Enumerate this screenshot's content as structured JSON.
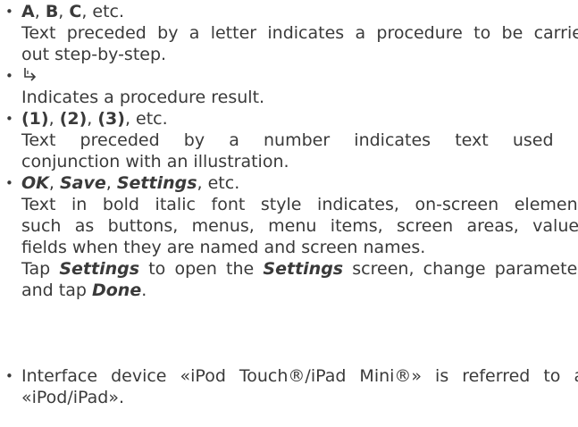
{
  "items": [
    {
      "lead": [
        {
          "text": "A",
          "style": "b"
        },
        {
          "text": ", ",
          "style": ""
        },
        {
          "text": "B",
          "style": "b"
        },
        {
          "text": ", ",
          "style": ""
        },
        {
          "text": "C",
          "style": "b"
        },
        {
          "text": ", etc.",
          "style": ""
        }
      ],
      "lines": [
        "Text preceded by a letter indicates a procedure to be carried",
        "out step-by-step."
      ]
    },
    {
      "symbol": "↳",
      "lines": [
        "Indicates a procedure result."
      ]
    },
    {
      "lead": [
        {
          "text": "(1)",
          "style": "b"
        },
        {
          "text": ", ",
          "style": ""
        },
        {
          "text": "(2)",
          "style": "b"
        },
        {
          "text": ", ",
          "style": ""
        },
        {
          "text": "(3)",
          "style": "b"
        },
        {
          "text": ", etc.",
          "style": ""
        }
      ],
      "lines": [
        "Text preceded by a number indicates text used in",
        "conjunction with an illustration."
      ]
    },
    {
      "lead": [
        {
          "text": "OK",
          "style": "bi"
        },
        {
          "text": ", ",
          "style": ""
        },
        {
          "text": "Save",
          "style": "bi"
        },
        {
          "text": ", ",
          "style": ""
        },
        {
          "text": "Settings",
          "style": "bi"
        },
        {
          "text": ", etc.",
          "style": ""
        }
      ],
      "lines": [
        "Text in bold italic font style indicates, on-screen elements",
        "such as buttons, menus, menu items, screen areas, values,",
        "fields when they are named and screen names."
      ],
      "example": {
        "line1": [
          {
            "text": "Tap ",
            "style": ""
          },
          {
            "text": "Settings",
            "style": "bi"
          },
          {
            "text": " to open the ",
            "style": ""
          },
          {
            "text": "Settings",
            "style": "bi"
          },
          {
            "text": " screen, change parameters",
            "style": ""
          }
        ],
        "line2": [
          {
            "text": "and tap ",
            "style": ""
          },
          {
            "text": "Done",
            "style": "bi"
          },
          {
            "text": ".",
            "style": ""
          }
        ]
      }
    },
    {
      "lines": [
        "Interface device «iPod Touch®/iPad Mini®» is referred to as",
        "«iPod/iPad»."
      ]
    }
  ],
  "bullet": "•"
}
